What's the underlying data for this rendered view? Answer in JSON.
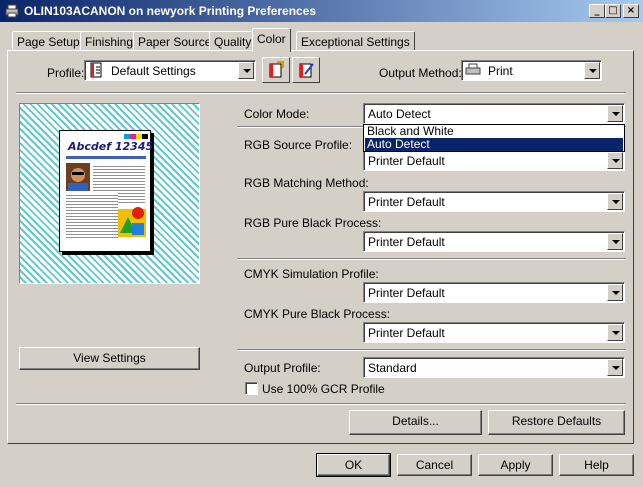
{
  "window": {
    "title": "OLIN103ACANON on newyork Printing Preferences",
    "minimize_glyph": "_",
    "maximize_glyph": "□",
    "close_glyph": "×"
  },
  "tabs": [
    {
      "label": "Page Setup"
    },
    {
      "label": "Finishing"
    },
    {
      "label": "Paper Source"
    },
    {
      "label": "Quality"
    },
    {
      "label": "Color",
      "active": true
    },
    {
      "label": "Exceptional Settings"
    }
  ],
  "profile": {
    "label": "Profile:",
    "value": "Default Settings"
  },
  "output_method": {
    "label": "Output Method:",
    "value": "Print"
  },
  "preview": {
    "sample_text": "Abcdef 12345"
  },
  "view_settings_label": "View Settings",
  "color_mode": {
    "label": "Color Mode:",
    "value": "Auto Detect",
    "options": [
      "Black and White",
      "Auto Detect"
    ],
    "selected_index": 1
  },
  "rgb_source_profile": {
    "label": "RGB Source Profile:",
    "value": "Printer Default"
  },
  "rgb_matching_method": {
    "label": "RGB Matching Method:",
    "value": "Printer Default"
  },
  "rgb_pure_black": {
    "label": "RGB Pure Black Process:",
    "value": "Printer Default"
  },
  "cmyk_simulation": {
    "label": "CMYK Simulation Profile:",
    "value": "Printer Default"
  },
  "cmyk_pure_black": {
    "label": "CMYK Pure Black Process:",
    "value": "Printer Default"
  },
  "output_profile": {
    "label": "Output Profile:",
    "value": "Standard"
  },
  "gcr_checkbox": {
    "label": "Use 100% GCR Profile",
    "checked": false
  },
  "details_label": "Details...",
  "restore_defaults_label": "Restore Defaults",
  "footer": {
    "ok_label": "OK",
    "cancel_label": "Cancel",
    "apply_label": "Apply",
    "help_label": "Help"
  },
  "colors": {
    "titlebar_start": "#0a246a",
    "titlebar_end": "#a6caf0",
    "face": "#d4d0c8",
    "selection": "#0a246a",
    "preview_stripe": "#5fc8d0"
  }
}
